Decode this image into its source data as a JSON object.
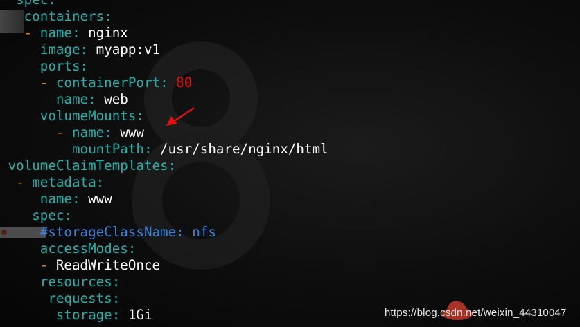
{
  "colors": {
    "key": "#20b2aa",
    "dash": "#e08a00",
    "number": "#e01010",
    "comment": "#3b82d8",
    "text": "#ffffff",
    "arrow": "#e01010"
  },
  "lines": [
    {
      "indent": "  ",
      "key": "spec"
    },
    {
      "indent": "   ",
      "key": "containers"
    },
    {
      "indent": "   ",
      "dash": true,
      "key": "name",
      "value": "nginx"
    },
    {
      "indent": "     ",
      "key": "image",
      "value": "myapp:v1"
    },
    {
      "indent": "     ",
      "key": "ports"
    },
    {
      "indent": "     ",
      "dash": true,
      "key": "containerPort",
      "value": "80",
      "value_type": "number"
    },
    {
      "indent": "       ",
      "key": "name",
      "value": "web"
    },
    {
      "indent": "     ",
      "key": "volumeMounts"
    },
    {
      "indent": "       ",
      "dash": true,
      "key": "name",
      "value": "www"
    },
    {
      "indent": "         ",
      "key": "mountPath",
      "value": "/usr/share/nginx/html"
    },
    {
      "indent": " ",
      "key": "volumeClaimTemplates"
    },
    {
      "indent": "  ",
      "dash": true,
      "key": "metadata"
    },
    {
      "indent": "     ",
      "key": "name",
      "value": "www"
    },
    {
      "indent": "    ",
      "key": "spec"
    },
    {
      "indent": "     ",
      "comment": "#storageClassName: nfs"
    },
    {
      "indent": "     ",
      "key": "accessModes"
    },
    {
      "indent": "     ",
      "dash": true,
      "value": "ReadWriteOnce"
    },
    {
      "indent": "     ",
      "key": "resources"
    },
    {
      "indent": "      ",
      "key": "requests"
    },
    {
      "indent": "       ",
      "key": "storage",
      "value": "1Gi"
    }
  ],
  "watermark": "https://blog.csdn.net/weixin_44310047",
  "icons": {
    "arrow": "red-arrow-icon",
    "wallpaper": "wallpaper-logo-icon",
    "watermark_logo": "redhat-logo-icon"
  }
}
